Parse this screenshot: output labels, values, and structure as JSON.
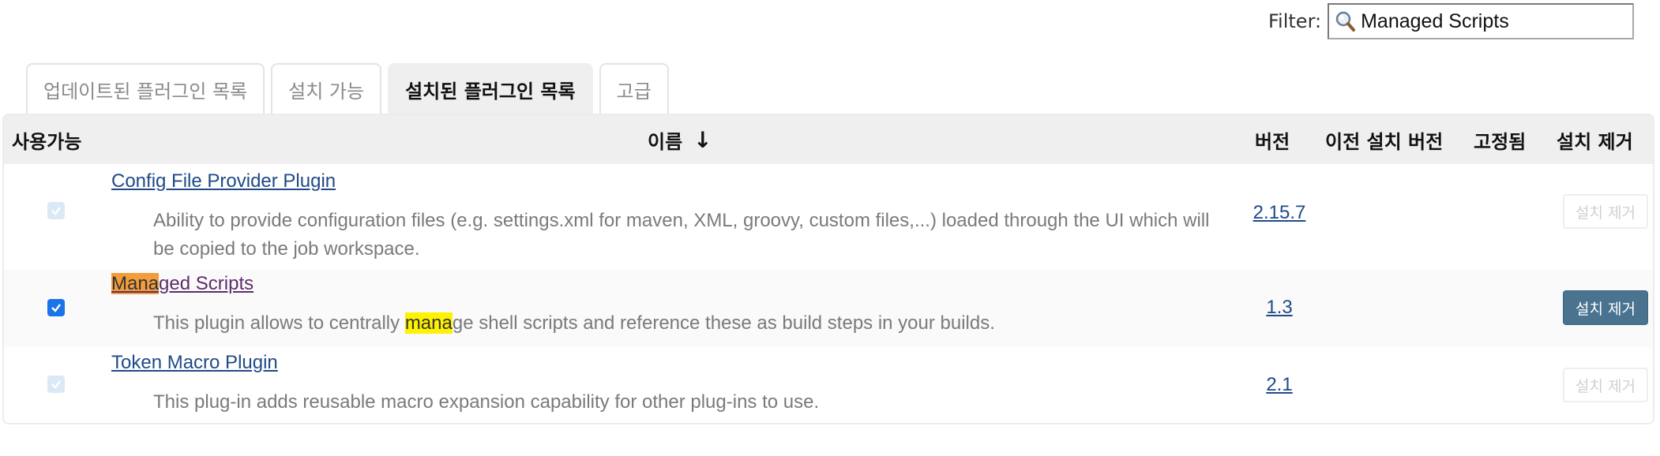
{
  "filter": {
    "label": "Filter:",
    "value": "Managed Scripts"
  },
  "tabs": [
    {
      "label": "업데이트된 플러그인 목록",
      "active": false
    },
    {
      "label": "설치 가능",
      "active": false
    },
    {
      "label": "설치된 플러그인 목록",
      "active": true
    },
    {
      "label": "고급",
      "active": false
    }
  ],
  "table": {
    "headers": {
      "enabled": "사용가능",
      "name": "이름",
      "sort_indicator": "↓",
      "version": "버전",
      "previous_version": "이전 설치 버전",
      "pinned": "고정됨",
      "uninstall": "설치 제거"
    },
    "rows": [
      {
        "name": "Config File Provider Plugin",
        "description": "Ability to provide configuration files (e.g. settings.xml for maven, XML, groovy, custom files,...) loaded through the UI which will be copied to the job workspace.",
        "version": "2.15.7",
        "enabled_checked": true,
        "checkbox_disabled": true,
        "uninstall_label": "설치 제거",
        "uninstall_enabled": false
      },
      {
        "name_highlight": "Mana",
        "name_rest": "ged Scripts",
        "description_prefix": "This plugin allows to centrally ",
        "description_highlight": "mana",
        "description_suffix": "ge shell scripts and reference these as build steps in your builds.",
        "version": "1.3",
        "enabled_checked": true,
        "checkbox_disabled": false,
        "uninstall_label": "설치 제거",
        "uninstall_enabled": true
      },
      {
        "name": "Token Macro Plugin",
        "description": "This plug-in adds reusable macro expansion capability for other plug-ins to use.",
        "version": "2.1",
        "enabled_checked": true,
        "checkbox_disabled": true,
        "uninstall_label": "설치 제거",
        "uninstall_enabled": false
      }
    ]
  },
  "colors": {
    "link": "#204a87",
    "visited_link": "#5c2d6b",
    "highlight_orange": "#f39c3c",
    "highlight_yellow": "#fff200",
    "uninstall_button": "#4a7390"
  },
  "icons": {
    "filter": "magnifier-icon",
    "checkbox": "checkmark-icon"
  }
}
